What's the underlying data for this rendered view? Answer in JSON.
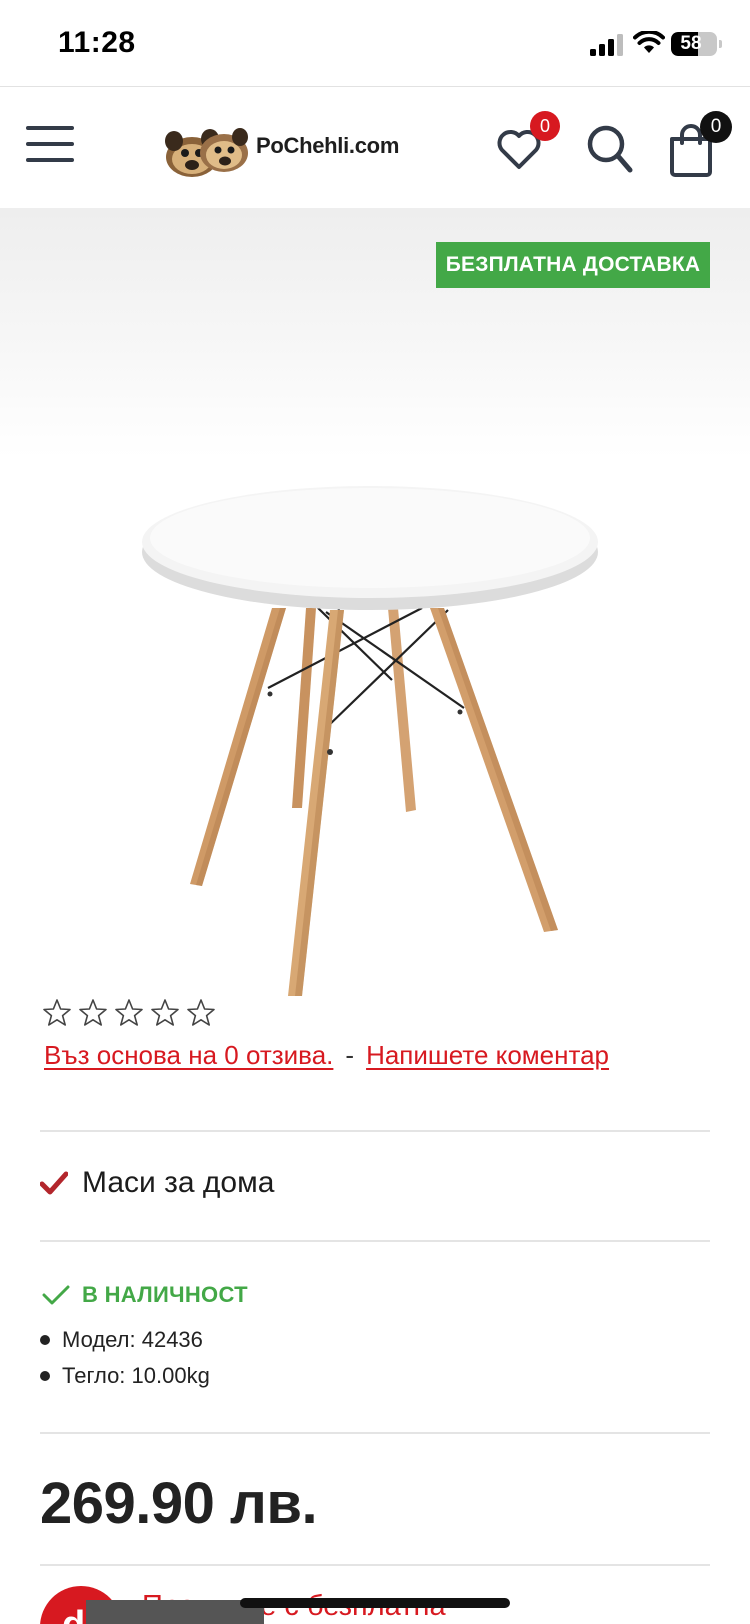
{
  "status_bar": {
    "time": "11:28",
    "battery_percent": "58",
    "battery_level": 0.58,
    "icons": [
      "signal-icon",
      "wifi-icon",
      "battery-icon"
    ]
  },
  "header": {
    "logo_text": "PoChehli.com",
    "wishlist_count": "0",
    "cart_count": "0",
    "icons": [
      "menu-icon",
      "heart-icon",
      "search-icon",
      "shopping-bag-icon"
    ]
  },
  "product": {
    "free_delivery_badge": "БЕЗПЛАТНА ДОСТАВКА",
    "rating": {
      "stars_filled": 0,
      "stars_total": 5
    },
    "reviews_link": "Въз основа на 0 отзива.",
    "separator": "-",
    "write_review_link": "Напишете коментар",
    "category": "Маси за дома",
    "stock_status": "В НАЛИЧНОСТ",
    "specs": [
      {
        "text": "Модел: 42436"
      },
      {
        "text": "Тегло: 10.00kg"
      }
    ],
    "price": "269.90 лв.",
    "promo_text": "Продукт е с безплатна"
  },
  "colors": {
    "accent_red": "#d71920",
    "stock_green": "#43a847",
    "text_dark": "#222222"
  }
}
